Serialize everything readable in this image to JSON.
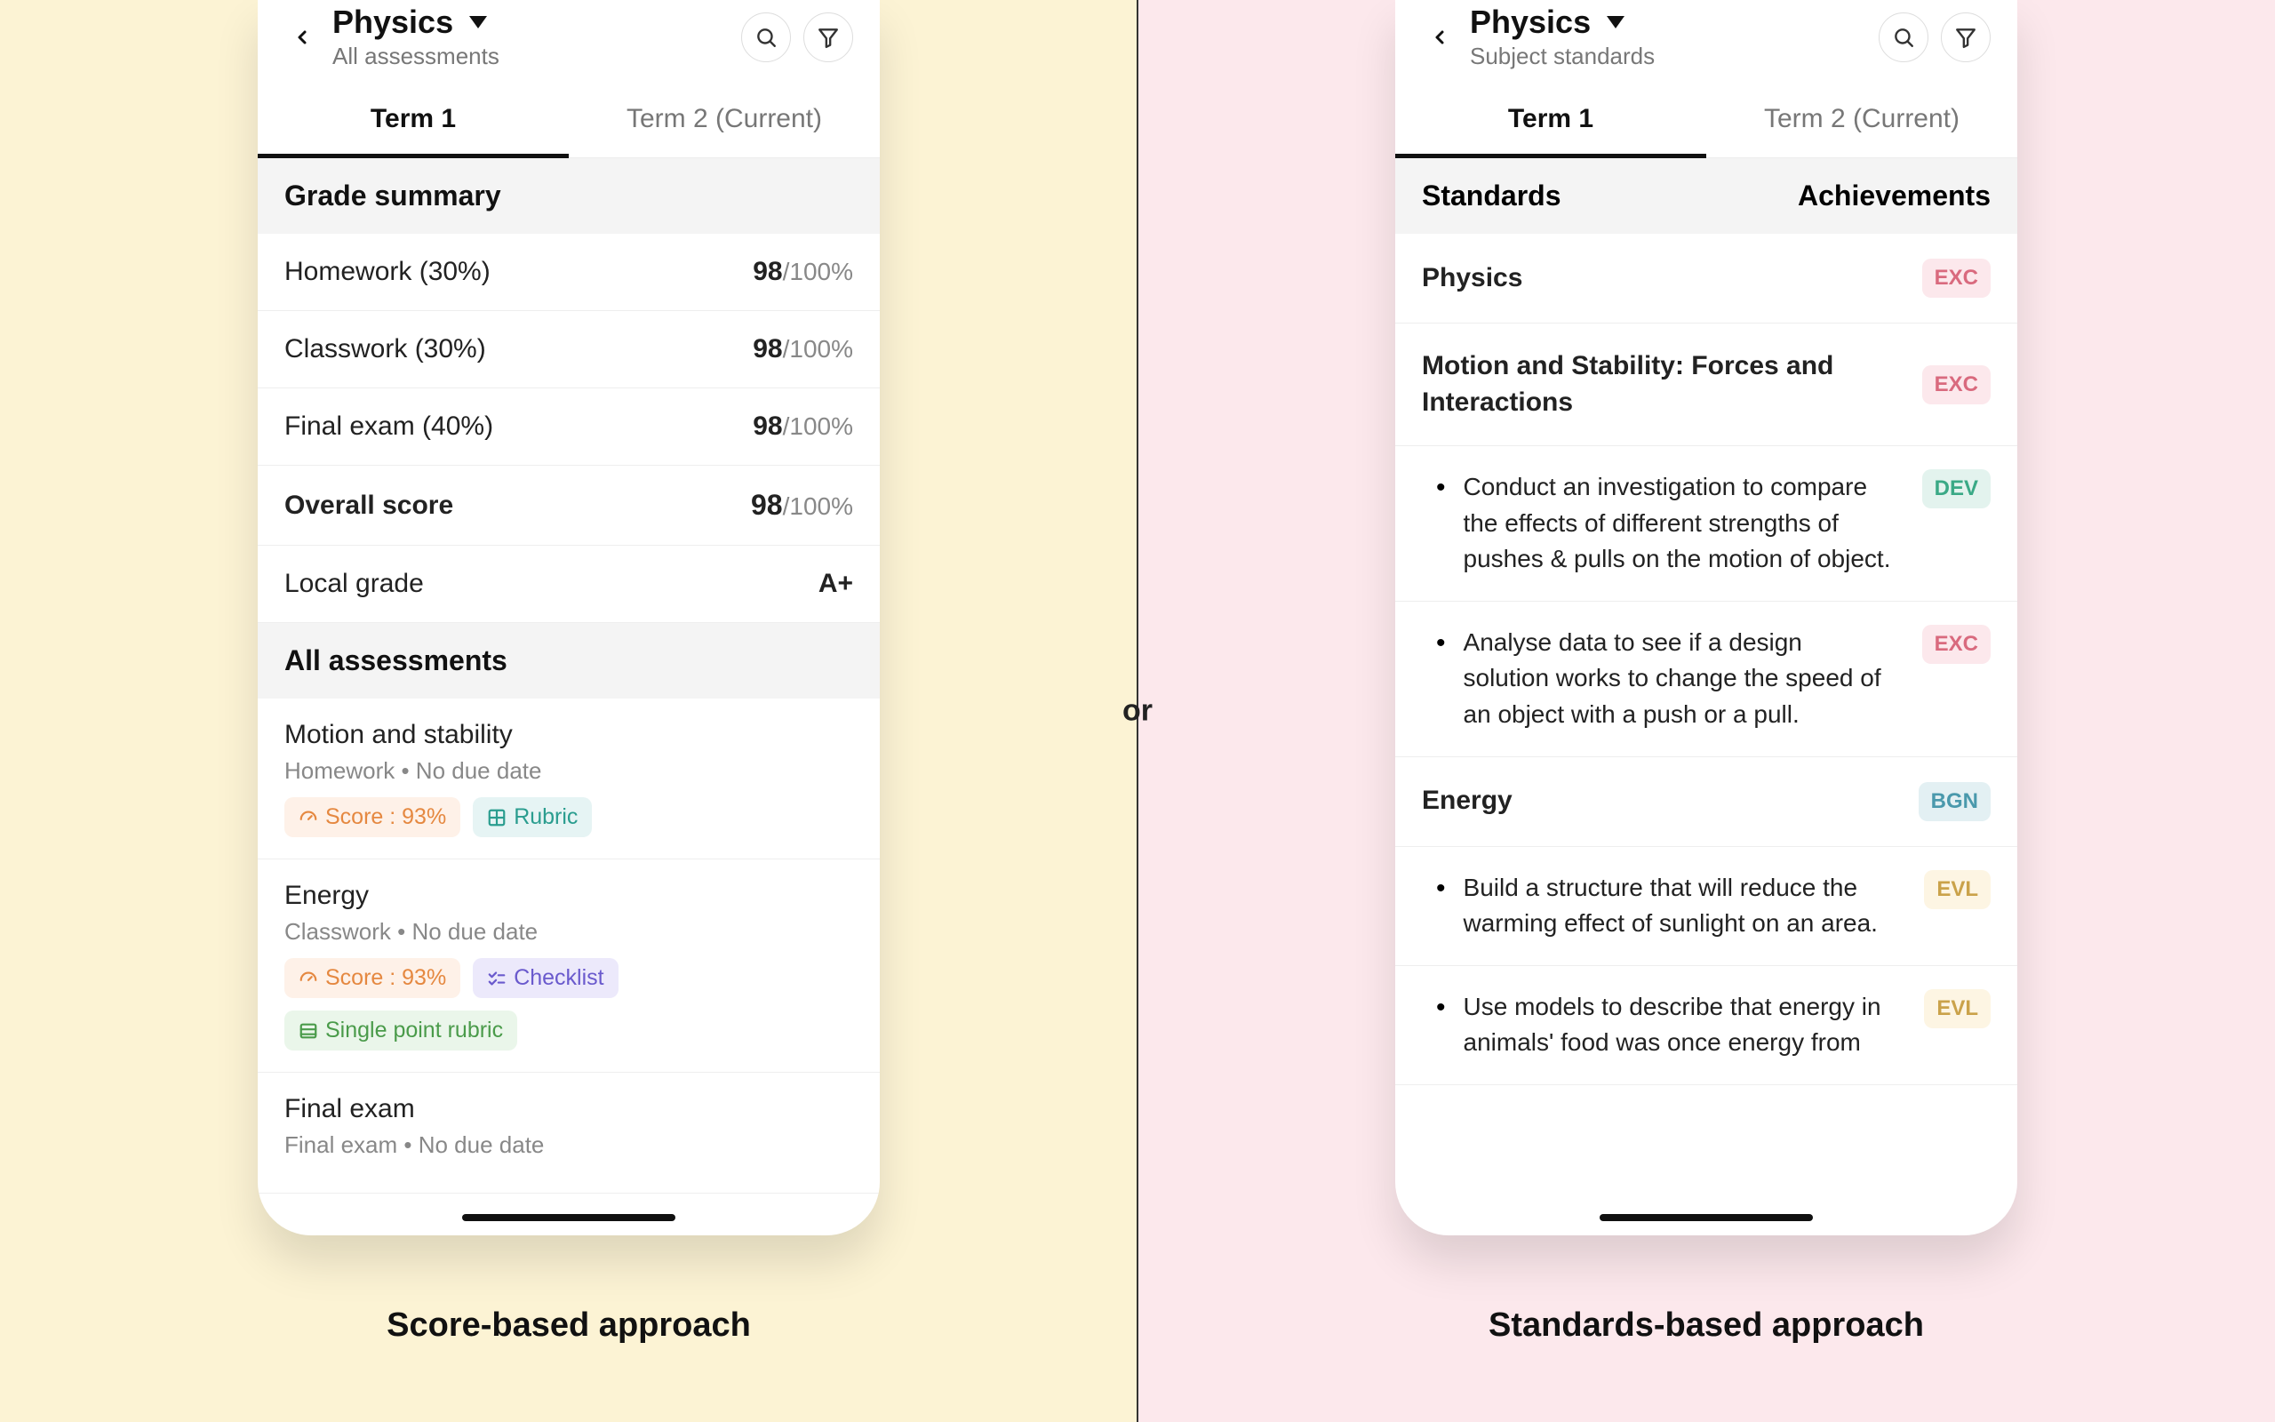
{
  "divider_label": "or",
  "left": {
    "header": {
      "title": "Physics",
      "subtitle": "All assessments"
    },
    "tabs": [
      "Term 1",
      "Term 2 (Current)"
    ],
    "grade_summary_title": "Grade summary",
    "grades": [
      {
        "label": "Homework (30%)",
        "score": "98",
        "total": "/100%"
      },
      {
        "label": "Classwork (30%)",
        "score": "98",
        "total": "/100%"
      },
      {
        "label": "Final exam (40%)",
        "score": "98",
        "total": "/100%"
      }
    ],
    "overall": {
      "label": "Overall score",
      "score": "98",
      "total": "/100%"
    },
    "local": {
      "label": "Local grade",
      "value": "A+"
    },
    "all_assessments_title": "All assessments",
    "assessments": [
      {
        "title": "Motion and stability",
        "meta": "Homework • No due date",
        "score_label": "Score : 93%",
        "rubric_label": "Rubric"
      },
      {
        "title": "Energy",
        "meta": "Classwork • No due date",
        "score_label": "Score : 93%",
        "checklist_label": "Checklist",
        "single_label": "Single point rubric"
      },
      {
        "title": "Final exam",
        "meta": "Final exam • No due date"
      }
    ],
    "caption": "Score-based approach"
  },
  "right": {
    "header": {
      "title": "Physics",
      "subtitle": "Subject standards"
    },
    "tabs": [
      "Term 1",
      "Term 2 (Current)"
    ],
    "col_left": "Standards",
    "col_right": "Achievements",
    "rows": [
      {
        "type": "main",
        "name": "Physics",
        "badge": "EXC",
        "badge_class": "badge-exc"
      },
      {
        "type": "main",
        "name": "Motion and Stability: Forces and Interactions",
        "badge": "EXC",
        "badge_class": "badge-exc"
      },
      {
        "type": "sub",
        "text": "Conduct an investigation to compare the effects of different strengths of pushes & pulls on the motion of object.",
        "badge": "DEV",
        "badge_class": "badge-dev"
      },
      {
        "type": "sub",
        "text": "Analyse data to see if a design solution works to change the speed of an object with a push or a pull.",
        "badge": "EXC",
        "badge_class": "badge-exc"
      },
      {
        "type": "main",
        "name": "Energy",
        "badge": "BGN",
        "badge_class": "badge-bgn"
      },
      {
        "type": "sub",
        "text": "Build a structure that will reduce the warming effect of sunlight on an area.",
        "badge": "EVL",
        "badge_class": "badge-evl"
      },
      {
        "type": "sub",
        "text": "Use models to describe that energy in animals' food  was once energy from",
        "badge": "EVL",
        "badge_class": "badge-evl"
      }
    ],
    "caption": "Standards-based approach"
  }
}
